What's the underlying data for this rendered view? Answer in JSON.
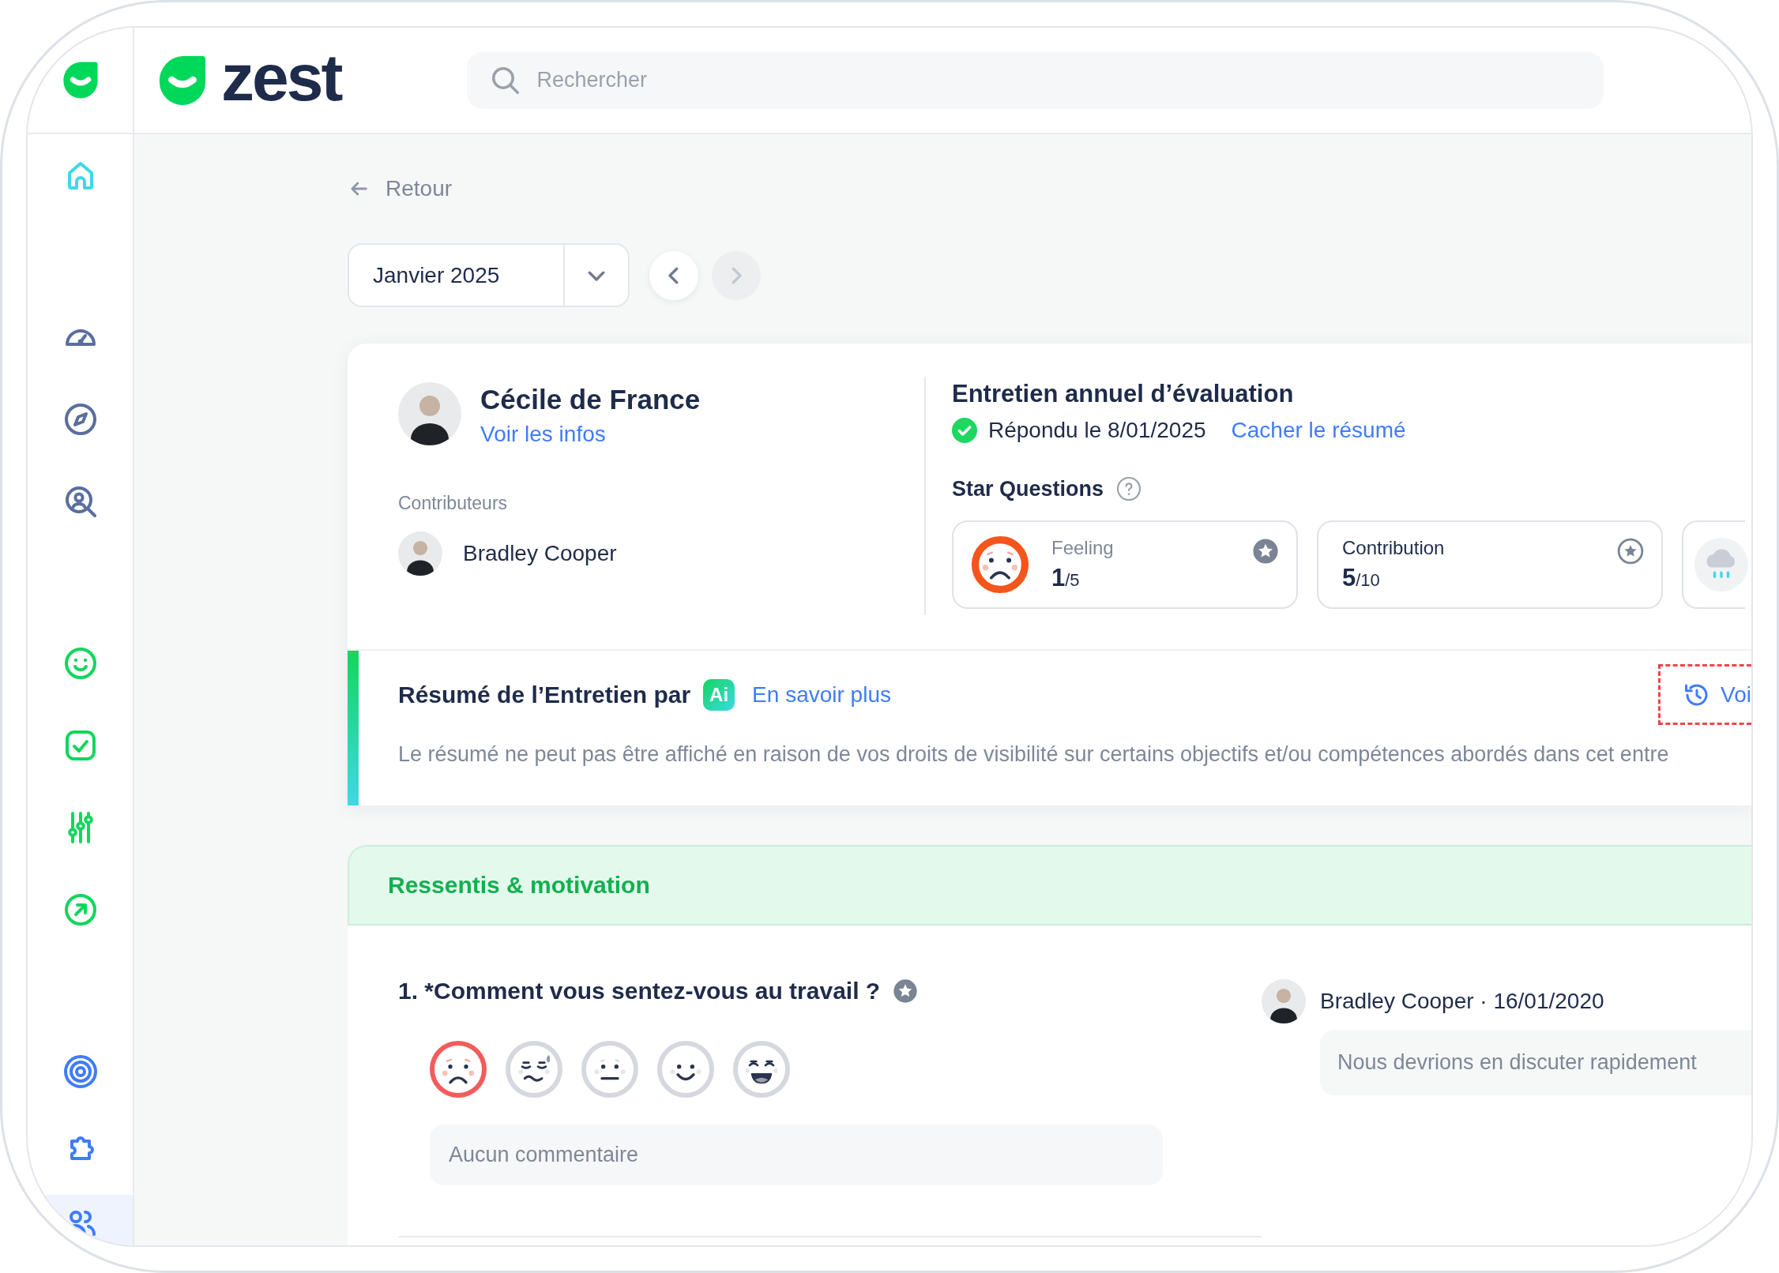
{
  "sidebar": {
    "groups": [
      {
        "items": [
          {
            "color": "#3fd8e6",
            "selected": false
          }
        ]
      },
      {
        "items": [
          {
            "color": "#5a6e9e",
            "selected": false
          },
          {
            "color": "#5a6e9e",
            "selected": false
          },
          {
            "color": "#5a6e9e",
            "selected": false
          }
        ]
      },
      {
        "items": [
          {
            "color": "#12d65c",
            "selected": false
          },
          {
            "color": "#12d65c",
            "selected": false
          },
          {
            "color": "#12d65c",
            "selected": false
          },
          {
            "color": "#12d65c",
            "selected": false
          }
        ]
      },
      {
        "items": [
          {
            "color": "#3f7cf7",
            "selected": false
          },
          {
            "color": "#3f7cf7",
            "selected": false
          },
          {
            "color": "#3f7cf7",
            "selected": true
          }
        ]
      }
    ]
  },
  "header": {
    "logo_text": "zest",
    "search": {
      "placeholder": "Rechercher"
    }
  },
  "back_link": "Retour",
  "period": {
    "value": "Janvier 2025",
    "prev_disabled": false,
    "next_disabled": true
  },
  "person": {
    "name": "Cécile de France",
    "link": "Voir les infos",
    "contributors_label": "Contributeurs",
    "contributors": [
      {
        "name": "Bradley Cooper"
      }
    ]
  },
  "review": {
    "title": "Entretien annuel d’évaluation",
    "status": "Répondu le 8/01/2025",
    "toggle_link": "Cacher le résumé",
    "star_questions_label": "Star Questions",
    "star_questions": [
      {
        "kind": "mood",
        "label": "Feeling",
        "score": "1",
        "scale": "/5",
        "starred": true
      },
      {
        "kind": "score",
        "label": "Contribution",
        "score": "5",
        "scale": "/10",
        "starred": false
      },
      {
        "kind": "weather"
      }
    ]
  },
  "summary": {
    "title": "Résumé de l’Entretien par",
    "badge": "Ai",
    "link": "En savoir plus",
    "history_button": "Voi",
    "text": "Le résumé ne peut pas être affiché en raison de vos droits de visibilité sur certains objectifs et/ou compétences abordés dans cet entre"
  },
  "section": {
    "title": "Ressentis & motivation",
    "questions": [
      {
        "text": "1. *Comment vous sentez-vous au travail ?",
        "starred": true,
        "options": [
          {
            "selected": true
          },
          {
            "selected": false
          },
          {
            "selected": false
          },
          {
            "selected": false
          },
          {
            "selected": false
          }
        ],
        "comment_placeholder": "Aucun commentaire",
        "reply": {
          "author": "Bradley Cooper · 16/01/2020",
          "text": "Nous devrions en discuter rapidement"
        }
      }
    ]
  }
}
